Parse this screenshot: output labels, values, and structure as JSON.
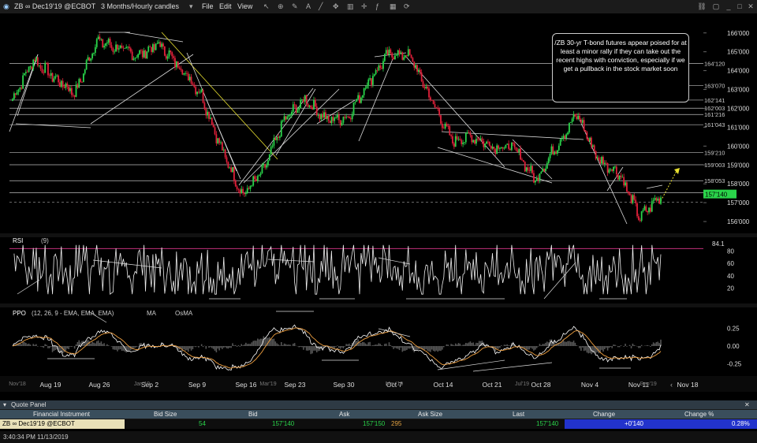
{
  "toolbar": {
    "symbol": "ZB",
    "contract": "∞ Dec19'19 @ECBOT",
    "timeframe": "3 Months/Hourly candles",
    "menu_file": "File",
    "menu_edit": "Edit",
    "menu_view": "View"
  },
  "annotation": "/ZB 30-yr T-bond futures appear poised for at least a minor rally if they can take out the recent highs with conviction, especially if we get a pullback in the stock market soon",
  "price_axis": {
    "ticks": [
      "166'000",
      "165'000",
      "164'000",
      "163'000",
      "162'000",
      "161'000",
      "160'000",
      "159'000",
      "158'000",
      "157'000",
      "156'000"
    ],
    "level_labels": [
      "164'120",
      "163'070",
      "162'141",
      "162'003",
      "161'216",
      "161'043",
      "159'210",
      "159'003",
      "158'053",
      "157'167"
    ],
    "last_price": "157'140",
    "last_price_color": "#2ad44a"
  },
  "rsi": {
    "label": "RSI",
    "period": "(9)",
    "overbought_value": "84.1",
    "ticks": [
      "80",
      "60",
      "40",
      "20"
    ]
  },
  "ppo": {
    "label": "PPO",
    "params": "(12, 26, 9 - EMA, EMA, EMA)",
    "ma_label": "MA",
    "osma_label": "OsMA",
    "ticks": [
      "0.25",
      "0.00",
      "-0.25"
    ],
    "ppo_color": "#ffffff",
    "ma_color": "#f0a040"
  },
  "x_axis": {
    "labels": [
      "Aug 19",
      "Aug 26",
      "Sep 2",
      "Sep 9",
      "Sep 16",
      "Sep 23",
      "Sep 30",
      "Oct 7",
      "Oct 14",
      "Oct 21",
      "Oct 28",
      "Nov 4",
      "Nov 11",
      "Nov 18"
    ],
    "minor_labels": [
      "Nov'18",
      "Jan'19",
      "Mar'19",
      "May'19",
      "Jul'19",
      "Sep'19"
    ]
  },
  "quote_panel": {
    "title": "Quote Panel",
    "headers": [
      "Financial Instrument",
      "Bid Size",
      "Bid",
      "Ask",
      "Ask Size",
      "Last",
      "Change",
      "Change %"
    ],
    "row": {
      "instrument": "ZB ∞ Dec19'19 @ECBOT",
      "bid_size": "54",
      "bid": "157'140",
      "ask": "157'150",
      "ask_size": "295",
      "last": "157'140",
      "change": "+0'140",
      "change_pct": "0.28%"
    }
  },
  "status_bar": {
    "time": "3:40:34 PM 11/13/2019"
  },
  "colors": {
    "up": "#2ad44a",
    "down": "#e0203a",
    "change_bg": "#2233cc"
  },
  "chart_data": {
    "type": "candlestick",
    "title": "",
    "price_range": [
      155.5,
      166.7
    ],
    "price_series_key_points": [
      {
        "x": "Aug 15",
        "y": 162.5
      },
      {
        "x": "Aug 16",
        "y": 164.6
      },
      {
        "x": "Aug 20",
        "y": 163.6
      },
      {
        "x": "Aug 22",
        "y": 162.8
      },
      {
        "x": "Aug 26",
        "y": 165.6
      },
      {
        "x": "Aug 28",
        "y": 165.2
      },
      {
        "x": "Aug 30",
        "y": 164.8
      },
      {
        "x": "Sep 3",
        "y": 165.4
      },
      {
        "x": "Sep 5",
        "y": 164.2
      },
      {
        "x": "Sep 9",
        "y": 162.8
      },
      {
        "x": "Sep 12",
        "y": 159.8
      },
      {
        "x": "Sep 16",
        "y": 157.4
      },
      {
        "x": "Sep 18",
        "y": 158.7
      },
      {
        "x": "Sep 23",
        "y": 161.4
      },
      {
        "x": "Sep 25",
        "y": 162.5
      },
      {
        "x": "Sep 27",
        "y": 161.4
      },
      {
        "x": "Oct 1",
        "y": 161.5
      },
      {
        "x": "Oct 3",
        "y": 163.4
      },
      {
        "x": "Oct 7",
        "y": 164.9
      },
      {
        "x": "Oct 9",
        "y": 164.8
      },
      {
        "x": "Oct 11",
        "y": 162.5
      },
      {
        "x": "Oct 15",
        "y": 160.3
      },
      {
        "x": "Oct 18",
        "y": 160.5
      },
      {
        "x": "Oct 22",
        "y": 160.0
      },
      {
        "x": "Oct 25",
        "y": 159.9
      },
      {
        "x": "Oct 29",
        "y": 158.2
      },
      {
        "x": "Nov 1",
        "y": 160.0
      },
      {
        "x": "Nov 4",
        "y": 161.7
      },
      {
        "x": "Nov 6",
        "y": 159.3
      },
      {
        "x": "Nov 8",
        "y": 158.6
      },
      {
        "x": "Nov 11",
        "y": 156.2
      },
      {
        "x": "Nov 13",
        "y": 157.4
      }
    ],
    "rsi_range": [
      0,
      100
    ],
    "ppo_range": [
      -0.4,
      0.4
    ]
  }
}
